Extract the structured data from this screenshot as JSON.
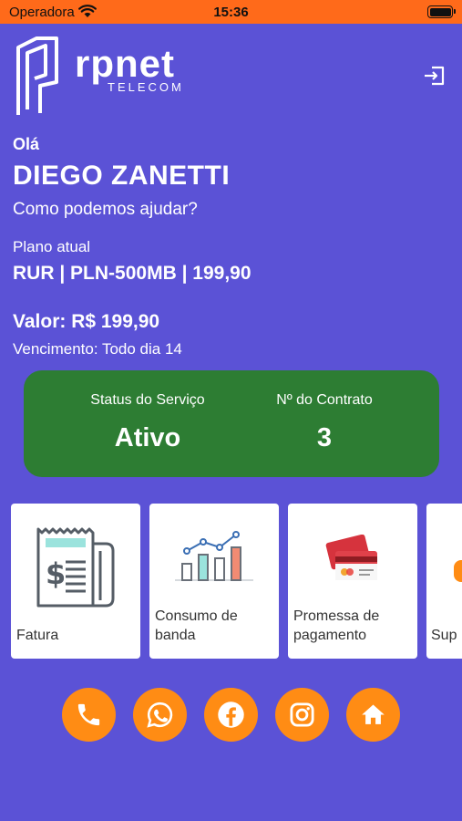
{
  "status_bar": {
    "carrier": "Operadora",
    "time": "15:36"
  },
  "logo": {
    "name": "rpnet",
    "subtitle": "TELECOM"
  },
  "greeting": {
    "hello": "Olá",
    "name": "DIEGO ZANETTI",
    "help": "Como podemos ajudar?"
  },
  "plan": {
    "label": "Plano atual",
    "name": "RUR | PLN-500MB | 199,90",
    "value": "Valor: R$ 199,90",
    "due": "Vencimento: Todo dia 14"
  },
  "status_card": {
    "service_label": "Status do Serviço",
    "service_value": "Ativo",
    "contract_label": "Nº do Contrato",
    "contract_value": "3",
    "color": "#2d7d33"
  },
  "tiles": [
    {
      "label": "Fatura",
      "icon": "invoice-icon"
    },
    {
      "label": "Consumo de banda",
      "icon": "bar-chart-icon"
    },
    {
      "label": "Promessa de pagamento",
      "icon": "credit-card-icon"
    },
    {
      "label": "Sup",
      "icon": "support-icon"
    }
  ],
  "social": [
    "phone-icon",
    "whatsapp-icon",
    "facebook-icon",
    "instagram-icon",
    "home-icon"
  ],
  "colors": {
    "background": "#5b52d6",
    "status_bar": "#ff6a1a",
    "accent": "#ff8c14"
  }
}
